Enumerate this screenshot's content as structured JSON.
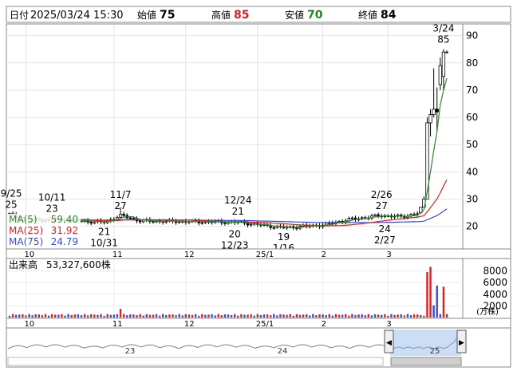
{
  "header": {
    "date_label": "日付",
    "date_value": "2025/03/24 15:30",
    "open_label": "始値",
    "open_value": "75",
    "high_label": "高値",
    "high_value": "85",
    "low_label": "安値",
    "low_value": "70",
    "close_label": "終値",
    "close_value": "84"
  },
  "ma_legend": [
    {
      "label": "MA(5)",
      "value": "59.40",
      "color": "#2e8b2e"
    },
    {
      "label": "MA(25)",
      "value": "31.92",
      "color": "#e02020"
    },
    {
      "label": "MA(75)",
      "value": "24.79",
      "color": "#3a4ad8"
    }
  ],
  "volume_label": "出来高",
  "volume_value": "53,327,600株",
  "volume_unit": "(万株)",
  "annotations": [
    {
      "text": "9/25",
      "sub": "25",
      "pos": "above",
      "x": 0.5,
      "y": 24.5
    },
    {
      "text": "10/11",
      "sub": "23",
      "pos": "above",
      "x": 13,
      "y": 23
    },
    {
      "text": "11/7",
      "sub": "27",
      "pos": "above",
      "x": 34,
      "y": 24
    },
    {
      "text": "21",
      "sub": "10/31",
      "pos": "below",
      "x": 29,
      "y": 21
    },
    {
      "text": "12/24",
      "sub": "21",
      "pos": "above",
      "x": 70,
      "y": 22
    },
    {
      "text": "20",
      "sub": "12/23",
      "pos": "below",
      "x": 69,
      "y": 20
    },
    {
      "text": "19",
      "sub": "1/16",
      "pos": "below",
      "x": 84,
      "y": 19
    },
    {
      "text": "2/26",
      "sub": "27",
      "pos": "above",
      "x": 114,
      "y": 24
    },
    {
      "text": "24",
      "sub": "2/27",
      "pos": "below",
      "x": 115,
      "y": 22
    },
    {
      "text": "3/24",
      "sub": "85",
      "pos": "above",
      "x": 133,
      "y": 85
    }
  ],
  "navigator": {
    "labels": [
      "23",
      "24",
      "25"
    ],
    "left_arrow": "◀",
    "right_arrow": "▶"
  },
  "chart_data": {
    "type": "candlestick",
    "price_axis": {
      "ticks": [
        20,
        30,
        40,
        50,
        60,
        70,
        80,
        90
      ],
      "ylim": [
        12,
        94
      ]
    },
    "volume_axis": {
      "ticks": [
        2000,
        4000,
        6000,
        8000
      ],
      "ylim": [
        0,
        10000
      ],
      "unit": "(万株)"
    },
    "x_ticks": [
      {
        "label": "10",
        "index": 5
      },
      {
        "label": "11",
        "index": 32
      },
      {
        "label": "12",
        "index": 54
      },
      {
        "label": "25/1",
        "index": 76
      },
      {
        "label": "2",
        "index": 96
      },
      {
        "label": "3",
        "index": 116
      }
    ],
    "n_points": 135,
    "price_segments": [
      {
        "from": 0,
        "to": 4,
        "start": 24.5,
        "end": 22
      },
      {
        "from": 4,
        "to": 13,
        "start": 22,
        "end": 22.5
      },
      {
        "from": 13,
        "to": 29,
        "start": 22.5,
        "end": 21.5
      },
      {
        "from": 29,
        "to": 34,
        "start": 21.5,
        "end": 24
      },
      {
        "from": 34,
        "to": 40,
        "start": 24,
        "end": 22
      },
      {
        "from": 40,
        "to": 70,
        "start": 22,
        "end": 21.5
      },
      {
        "from": 70,
        "to": 84,
        "start": 21.5,
        "end": 19.5
      },
      {
        "from": 84,
        "to": 96,
        "start": 19.5,
        "end": 20.5
      },
      {
        "from": 96,
        "to": 104,
        "start": 20.5,
        "end": 22.5
      },
      {
        "from": 104,
        "to": 114,
        "start": 22.5,
        "end": 24
      },
      {
        "from": 114,
        "to": 120,
        "start": 24,
        "end": 23.5
      },
      {
        "from": 120,
        "to": 126,
        "start": 23.5,
        "end": 25
      }
    ],
    "final_candles": [
      {
        "i": 126,
        "o": 25,
        "h": 27,
        "l": 25,
        "c": 27
      },
      {
        "i": 127,
        "o": 27,
        "h": 31,
        "l": 27,
        "c": 30
      },
      {
        "i": 128,
        "o": 30,
        "h": 60,
        "l": 38,
        "c": 58
      },
      {
        "i": 129,
        "o": 58,
        "h": 63,
        "l": 53,
        "c": 61
      },
      {
        "i": 130,
        "o": 61,
        "h": 78,
        "l": 60,
        "c": 63
      },
      {
        "i": 131,
        "o": 63,
        "h": 71,
        "l": 55,
        "c": 62
      },
      {
        "i": 132,
        "o": 72,
        "h": 82,
        "l": 70,
        "c": 79
      },
      {
        "i": 133,
        "o": 75,
        "h": 85,
        "l": 70,
        "c": 84
      }
    ],
    "volume_spikes": [
      {
        "i": 34,
        "v": 1500,
        "color": "#e02020"
      },
      {
        "i": 127,
        "v": 300,
        "color": "#e02020"
      },
      {
        "i": 128,
        "v": 7800,
        "color": "#e02020"
      },
      {
        "i": 129,
        "v": 8700,
        "color": "#e02020"
      },
      {
        "i": 130,
        "v": 2100,
        "color": "#3a4ad8"
      },
      {
        "i": 131,
        "v": 5500,
        "color": "#3a4ad8"
      },
      {
        "i": 133,
        "v": 5300,
        "color": "#e02020"
      }
    ],
    "volume_base": 500
  }
}
